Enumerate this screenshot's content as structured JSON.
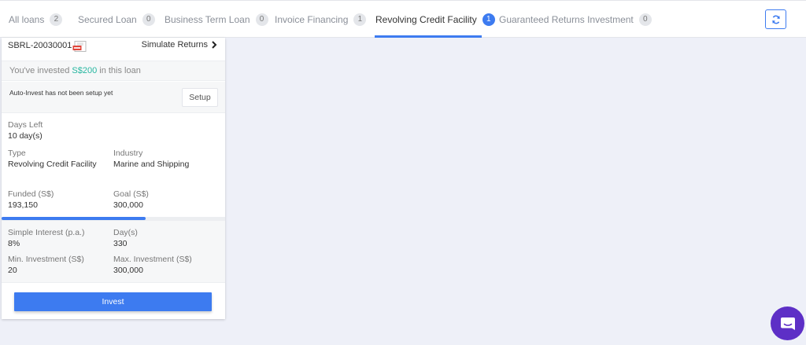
{
  "tabs": [
    {
      "label": "All loans",
      "count": "2"
    },
    {
      "label": "Secured Loan",
      "count": "0"
    },
    {
      "label": "Business Term Loan",
      "count": "0"
    },
    {
      "label": "Invoice Financing",
      "count": "1"
    },
    {
      "label": "Revolving Credit Facility",
      "count": "1"
    },
    {
      "label": "Guaranteed Returns Investment",
      "count": "0"
    }
  ],
  "active_tab": "Revolving Credit Facility",
  "card": {
    "loan_id": "SBRL-20030001",
    "simulate_label": "Simulate Returns",
    "invested_prefix": "You've invested",
    "invested_amount": "S$200",
    "invested_suffix": "in this loan",
    "autoinvest_text": "Auto-Invest has not been setup yet",
    "setup_label": "Setup",
    "days_left_label": "Days Left",
    "days_left_value": "10 day(s)",
    "type_label": "Type",
    "type_value": "Revolving Credit Facility",
    "industry_label": "Industry",
    "industry_value": "Marine and Shipping",
    "funded_label": "Funded (S$)",
    "funded_value": "193,150",
    "goal_label": "Goal (S$)",
    "goal_value": "300,000",
    "funded_fraction": 0.644,
    "interest_label": "Simple Interest (p.a.)",
    "interest_value": "8%",
    "days_label": "Day(s)",
    "days_value": "330",
    "min_label": "Min. Investment (S$)",
    "min_value": "20",
    "max_label": "Max. Investment (S$)",
    "max_value": "300,000",
    "invest_label": "Invest"
  },
  "colors": {
    "accent": "#3d7bf0",
    "invested_amount": "#27b6a0",
    "chat": "#5d2fc6"
  },
  "icons": {
    "refresh": "refresh-icon",
    "pdf": "pdf-icon",
    "chevron": "chevron-right-icon",
    "chat": "chat-icon"
  }
}
